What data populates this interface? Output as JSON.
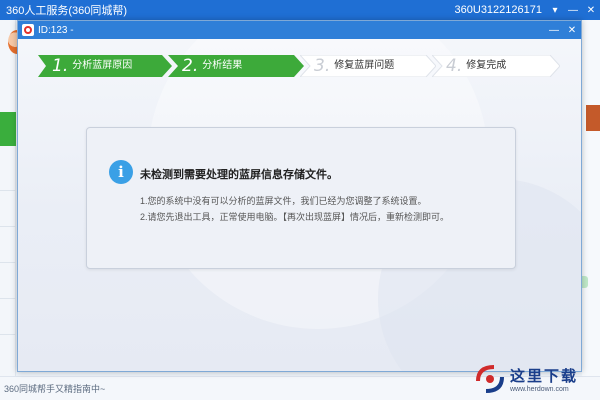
{
  "outer_window": {
    "title": "360人工服务(360同城帮)",
    "user": "360U3122126171",
    "controls": {
      "dropdown": "▾",
      "minimize": "—",
      "close": "✕"
    },
    "bottom_text": "360同城帮手又精指南中~"
  },
  "dialog": {
    "title": "ID:123 -",
    "controls": {
      "minimize": "—",
      "close": "✕"
    },
    "steps": [
      {
        "num": "1.",
        "label": "分析蓝屏原因",
        "state": "active"
      },
      {
        "num": "2.",
        "label": "分析结果",
        "state": "active"
      },
      {
        "num": "3.",
        "label": "修复蓝屏问题",
        "state": "inactive"
      },
      {
        "num": "4.",
        "label": "修复完成",
        "state": "inactive"
      }
    ],
    "message": {
      "icon": "i",
      "heading": "未检测到需要处理的蓝屏信息存储文件。",
      "lines": [
        "1.您的系统中没有可以分析的蓝屏文件，我们已经为您调整了系统设置。",
        "2.请您先退出工具，正常使用电脑。【再次出现蓝屏】情况后，重新检测即可。"
      ]
    }
  },
  "watermark": {
    "text": "这里下载",
    "url": "www.herdown.com"
  },
  "colors": {
    "outer_titlebar": "#1f6fd4",
    "dialog_titlebar": "#2f7fd8",
    "step_active": "#3daa3a",
    "step_inactive": "#ffffff",
    "info_icon": "#3aa0e6"
  }
}
